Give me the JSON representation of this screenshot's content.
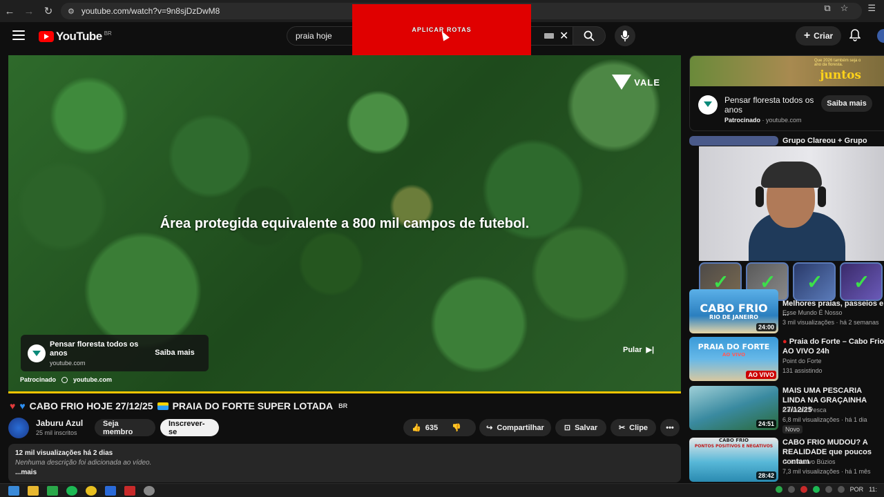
{
  "browser": {
    "url": "youtube.com/watch?v=9n8sjDzDwM8"
  },
  "masthead": {
    "logo_text": "YouTube",
    "country_code": "BR",
    "search_value": "praia hoje",
    "create_label": "Criar"
  },
  "overlay": {
    "label": "APLICAR ROTAS",
    "color": "#e00000"
  },
  "player": {
    "brand": "VALE",
    "caption": "Área protegida equivalente a 800 mil campos de futebol.",
    "ad_title": "Pensar floresta todos os anos",
    "ad_domain": "youtube.com",
    "ad_button": "Saiba mais",
    "sponsored": "Patrocinado",
    "sponsored_domain": "youtube.com",
    "skip_label": "Pular",
    "progress_color": "#f6c400"
  },
  "video": {
    "title": "CABO FRIO HOJE 27/12/25",
    "title_tail": "PRAIA DO FORTE SUPER LOTADA",
    "title_badge": "BR",
    "channel": "Jaburu Azul",
    "subscribers": "25 mil inscritos",
    "join_label": "Seja membro",
    "subscribe_label": "Inscrever-se",
    "likes": "635",
    "share_label": "Compartilhar",
    "save_label": "Salvar",
    "clip_label": "Clipe"
  },
  "description": {
    "stats": "12 mil visualizações  há 2 dias",
    "text": "Nenhuma descrição foi adicionada ao vídeo.",
    "more": "...mais"
  },
  "sidebar": {
    "ad": {
      "banner_word": "juntos",
      "banner_small": "Que 2026 também seja o ano da floresta.",
      "title": "Pensar floresta todos os anos",
      "sponsored": "Patrocinado",
      "domain": "youtube.com",
      "button": "Saiba mais"
    },
    "partial_title": "Grupo Clareou + Grupo",
    "items": [
      {
        "thumb_text": "CABO FRIO",
        "thumb_sub": "RIO DE JANEIRO",
        "duration": "24:00",
        "title": "Melhores praias, passeios e ...",
        "channel": "Esse Mundo É Nosso",
        "meta": "3 mil visualizações · há 2 semanas"
      },
      {
        "thumb_text": "PRAIA DO FORTE",
        "thumb_sub": "AO VIVO",
        "live_badge": "AO VIVO",
        "title": "Praia do Forte – Cabo Frio AO VIVO 24h",
        "channel": "Point do Forte",
        "meta": "131 assistindo"
      },
      {
        "duration": "24:51",
        "title": "MAIS UMA PESCARIA LINDA NA GRAÇAINHA 27/12/25",
        "channel": "Canal da Pesca",
        "meta": "6,8 mil visualizações · há 1 dia",
        "badge": "Novo"
      },
      {
        "thumb_text": "CABO FRIO",
        "thumb_sub": "PONTOS POSITIVOS E NEGATIVOS",
        "duration": "28:42",
        "title": "CABO FRIO MUDOU? A REALIDADE que poucos contam",
        "channel": "Guia Nativo Búzios",
        "meta": "7,3 mil visualizações · há 1 mês"
      }
    ]
  },
  "taskbar": {
    "lang": "POR",
    "time": "11:"
  }
}
